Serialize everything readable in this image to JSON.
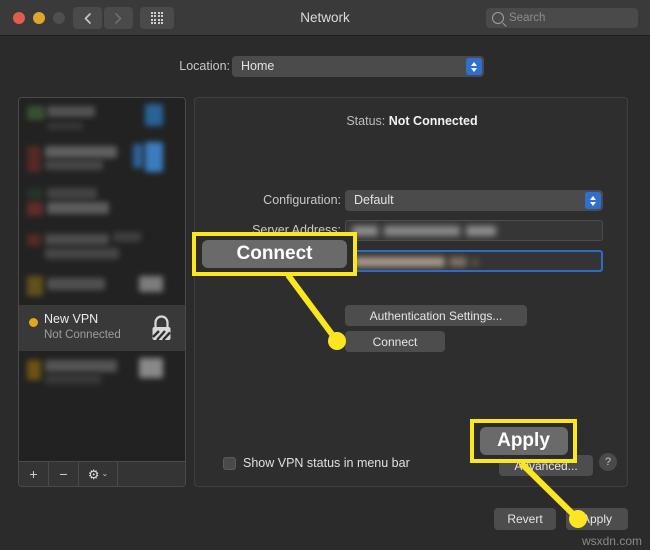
{
  "window": {
    "title": "Network",
    "traffic_lights": [
      "close",
      "minimize",
      "zoom"
    ],
    "nav_back_icon": "chevron-left-icon",
    "nav_forward_icon": "chevron-right-icon",
    "grid_icon": "show-all-grid-icon",
    "search": {
      "placeholder": "Search",
      "icon": "search-icon",
      "value": ""
    }
  },
  "location": {
    "label": "Location:",
    "value": "Home",
    "options": [
      "Home"
    ]
  },
  "sidebar": {
    "selected": {
      "name": "New VPN",
      "status": "Not Connected",
      "status_color": "#e6a520",
      "icon": "vpn-lock-icon"
    },
    "toolbar": {
      "add_label": "+",
      "remove_label": "−",
      "gear_label": "⚙",
      "chevron_label": "⌄"
    },
    "hidden_items_note": "blurred service list entries"
  },
  "detail": {
    "status_label": "Status:",
    "status_value": "Not Connected",
    "configuration_label": "Configuration:",
    "configuration_value": "Default",
    "server_address_label": "Server Address:",
    "server_address_value": "",
    "account_name_value": "",
    "auth_settings_label": "Authentication Settings...",
    "connect_label": "Connect",
    "show_status_label": "Show VPN status in menu bar",
    "show_status_checked": false,
    "advanced_label": "Advanced...",
    "help_label": "?"
  },
  "footer": {
    "revert_label": "Revert",
    "apply_label": "Apply"
  },
  "annotations": {
    "accent_color": "#fbe620",
    "callout_connect": "Connect",
    "callout_apply": "Apply"
  },
  "watermark": "wsxdn.com"
}
